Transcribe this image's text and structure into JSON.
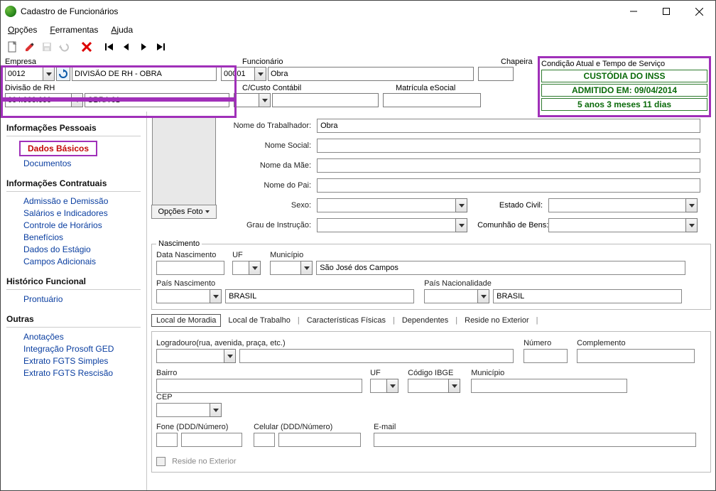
{
  "window": {
    "title": "Cadastro de Funcionários"
  },
  "menu": {
    "opcoes": "Opções",
    "ferramentas": "Ferramentas",
    "ajuda": "Ajuda"
  },
  "header": {
    "empresa_label": "Empresa",
    "empresa_value": "0012",
    "empresa_desc": "DIVISÃO DE RH - OBRA",
    "funcionario_label": "Funcionário",
    "funcionario_value": "00001",
    "funcionario_desc": "Obra",
    "chapeira_label": "Chapeira",
    "chapeira_value": "",
    "divisao_label": "Divisão de RH",
    "divisao_value": "004.000.000",
    "divisao_desc": "OBRA 01",
    "ccusto_label": "C/Custo Contábil",
    "ccusto_value": "",
    "ccusto_desc": "",
    "matricula_label": "Matrícula eSocial",
    "matricula_value": ""
  },
  "status": {
    "title": "Condição Atual e Tempo de Serviço",
    "line1": "CUSTÓDIA DO INSS",
    "line2": "ADMITIDO EM: 09/04/2014",
    "line3": "5 anos 3 meses 11 dias"
  },
  "sidebar": {
    "group1": "Informações Pessoais",
    "link_dados": "Dados Básicos",
    "link_docs": "Documentos",
    "group2": "Informações Contratuais",
    "link_adm": "Admissão e Demissão",
    "link_sal": "Salários e Indicadores",
    "link_hor": "Controle de Horários",
    "link_ben": "Benefícios",
    "link_est": "Dados do Estágio",
    "link_cad": "Campos Adicionais",
    "group3": "Histórico Funcional",
    "link_pro": "Prontuário",
    "group4": "Outras",
    "link_ano": "Anotações",
    "link_ged": "Integração Prosoft GED",
    "link_fs": "Extrato FGTS Simples",
    "link_fr": "Extrato FGTS Rescisão"
  },
  "form": {
    "photo_opt": "Opções Foto",
    "nome_trab_lbl": "Nome do Trabalhador:",
    "nome_trab": "Obra",
    "nome_social_lbl": "Nome Social:",
    "nome_social": "",
    "nome_mae_lbl": "Nome da Mãe:",
    "nome_mae": "",
    "nome_pai_lbl": "Nome do Pai:",
    "nome_pai": "",
    "sexo_lbl": "Sexo:",
    "sexo": "",
    "estado_civil_lbl": "Estado Civil:",
    "estado_civil": "",
    "grau_lbl": "Grau de Instrução:",
    "grau": "",
    "comunhao_lbl": "Comunhão de Bens:",
    "comunhao": ""
  },
  "nascimento": {
    "legend": "Nascimento",
    "data_lbl": "Data Nascimento",
    "data": "",
    "uf_lbl": "UF",
    "uf": "",
    "municipio_lbl": "Município",
    "municipio_code": "",
    "municipio": "São José dos Campos",
    "pais_nasc_lbl": "País Nascimento",
    "pais_nasc_code": "",
    "pais_nasc": "BRASIL",
    "pais_nac_lbl": "País Nacionalidade",
    "pais_nac_code": "",
    "pais_nac": "BRASIL"
  },
  "tabs": {
    "t1": "Local de Moradia",
    "t2": "Local de Trabalho",
    "t3": "Características Físicas",
    "t4": "Dependentes",
    "t5": "Reside no Exterior"
  },
  "moradia": {
    "logradouro_lbl": "Logradouro(rua, avenida, praça, etc.)",
    "numero_lbl": "Número",
    "compl_lbl": "Complemento",
    "bairro_lbl": "Bairro",
    "uf_lbl": "UF",
    "ibge_lbl": "Código IBGE",
    "municipio_lbl": "Município",
    "cep_lbl": "CEP",
    "fone_lbl": "Fone (DDD/Número)",
    "cel_lbl": "Celular (DDD/Número)",
    "email_lbl": "E-mail",
    "reside_ext": "Reside no Exterior"
  }
}
